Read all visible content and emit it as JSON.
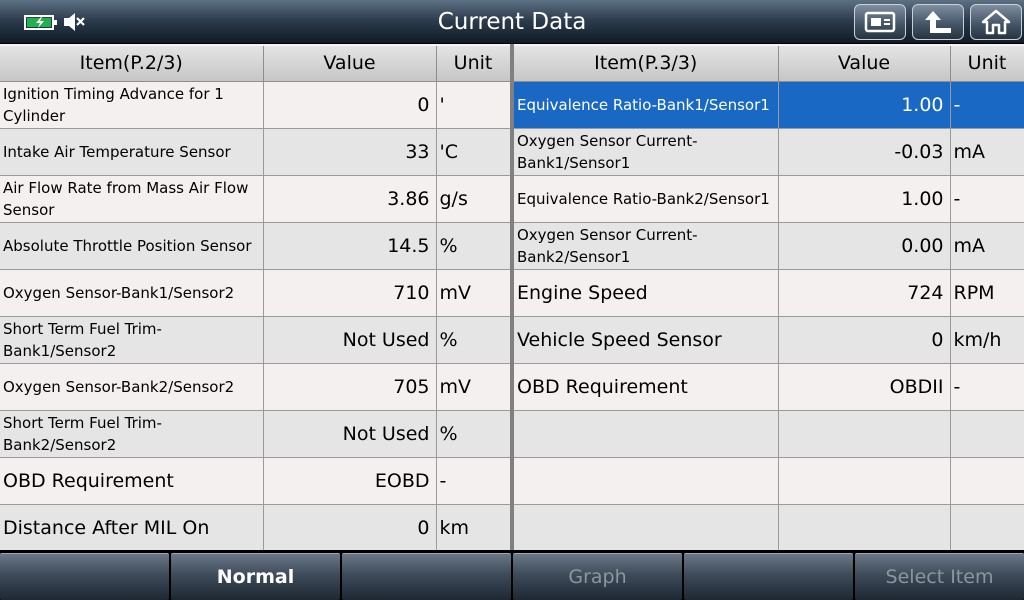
{
  "title": "Current Data",
  "status_icons": [
    "battery-icon",
    "mute-icon"
  ],
  "nav_icons": [
    "print-icon",
    "back-icon",
    "home-icon"
  ],
  "left_table": {
    "headers": {
      "item": "Item(P.2/3)",
      "value": "Value",
      "unit": "Unit"
    },
    "rows": [
      {
        "item": "Ignition Timing Advance for 1 Cylinder",
        "value": "0",
        "unit": "'"
      },
      {
        "item": "Intake Air Temperature Sensor",
        "value": "33",
        "unit": "'C"
      },
      {
        "item": "Air Flow Rate from Mass Air Flow Sensor",
        "value": "3.86",
        "unit": "g/s"
      },
      {
        "item": "Absolute Throttle Position Sensor",
        "value": "14.5",
        "unit": "%"
      },
      {
        "item": "Oxygen Sensor-Bank1/Sensor2",
        "value": "710",
        "unit": "mV"
      },
      {
        "item": "Short Term Fuel Trim-Bank1/Sensor2",
        "value": "Not Used",
        "unit": "%"
      },
      {
        "item": "Oxygen Sensor-Bank2/Sensor2",
        "value": "705",
        "unit": "mV"
      },
      {
        "item": "Short Term Fuel Trim-Bank2/Sensor2",
        "value": "Not Used",
        "unit": "%"
      },
      {
        "item": "OBD Requirement",
        "value": "EOBD",
        "unit": "-"
      },
      {
        "item": "Distance After MIL On",
        "value": "0",
        "unit": "km"
      }
    ]
  },
  "right_table": {
    "headers": {
      "item": "Item(P.3/3)",
      "value": "Value",
      "unit": "Unit"
    },
    "rows": [
      {
        "item": "Equivalence Ratio-Bank1/Sensor1",
        "value": "1.00",
        "unit": "-"
      },
      {
        "item": "Oxygen Sensor Current-Bank1/Sensor1",
        "value": "-0.03",
        "unit": "mA"
      },
      {
        "item": "Equivalence Ratio-Bank2/Sensor1",
        "value": "1.00",
        "unit": "-"
      },
      {
        "item": "Oxygen Sensor Current-Bank2/Sensor1",
        "value": "0.00",
        "unit": "mA"
      },
      {
        "item": "Engine Speed",
        "value": "724",
        "unit": "RPM"
      },
      {
        "item": "Vehicle Speed Sensor",
        "value": "0",
        "unit": "km/h"
      },
      {
        "item": "OBD Requirement",
        "value": "OBDII",
        "unit": "-"
      },
      {
        "item": "",
        "value": "",
        "unit": ""
      },
      {
        "item": "",
        "value": "",
        "unit": ""
      },
      {
        "item": "",
        "value": "",
        "unit": ""
      }
    ]
  },
  "bottom_buttons": [
    {
      "label": "",
      "enabled": false
    },
    {
      "label": "Normal",
      "enabled": true
    },
    {
      "label": "",
      "enabled": false
    },
    {
      "label": "Graph",
      "enabled": false
    },
    {
      "label": "",
      "enabled": false
    },
    {
      "label": "Select Item",
      "enabled": false
    }
  ],
  "colors": {
    "selected_row": "#1868c4",
    "battery_fill": "#22b14c"
  }
}
